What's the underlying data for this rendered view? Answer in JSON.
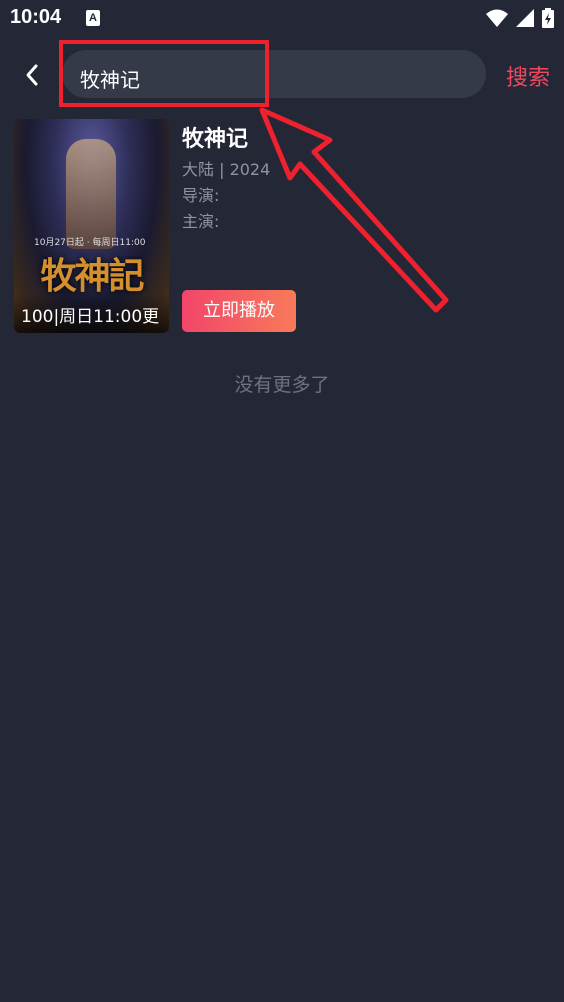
{
  "status_bar": {
    "time": "10:04",
    "notification_letter": "A"
  },
  "search": {
    "query": "牧神记",
    "button_label": "搜索"
  },
  "result": {
    "title": "牧神记",
    "region_year": "大陆 | 2024",
    "director_label": "导演:",
    "cast_label": "主演:",
    "poster_caption": "100|周日11:00更",
    "poster_logo": "牧神記",
    "poster_small_text": "10月27日起 · 每周日11:00",
    "play_label": "立即播放"
  },
  "footer": {
    "no_more": "没有更多了"
  },
  "colors": {
    "background": "#242836",
    "accent": "#f04860",
    "highlight": "#f0212e"
  }
}
